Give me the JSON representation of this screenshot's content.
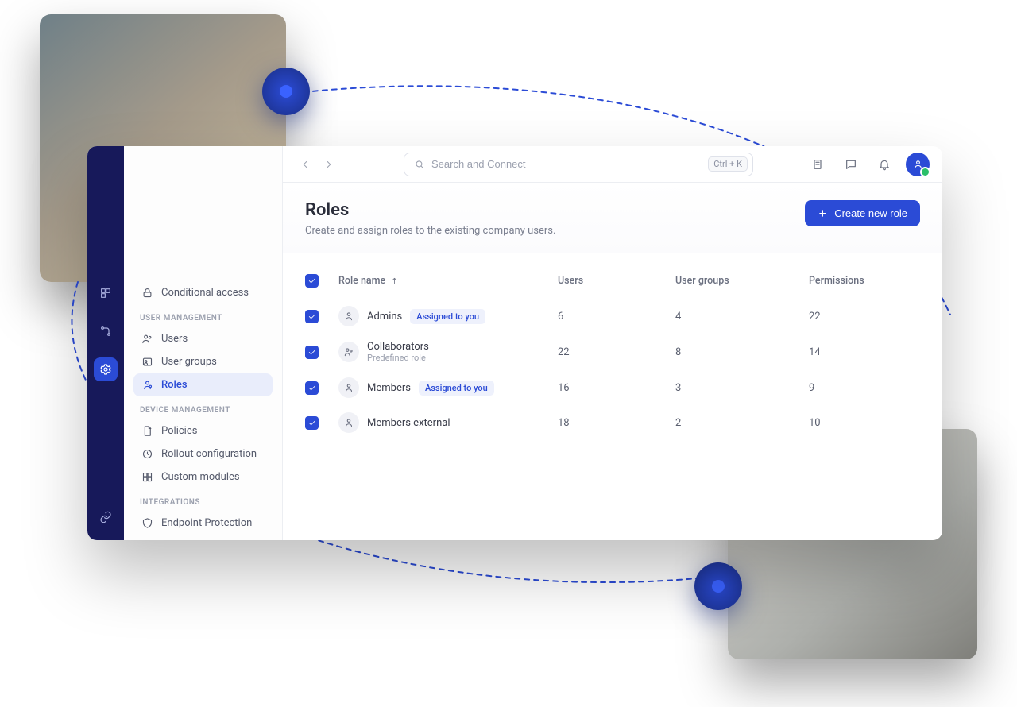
{
  "search": {
    "placeholder": "Search and Connect",
    "shortcut": "Ctrl + K"
  },
  "page": {
    "title": "Roles",
    "subtitle": "Create and assign roles to the existing company users.",
    "cta_label": "Create new role"
  },
  "sidebar": {
    "top_item": "Conditional access",
    "sections": [
      {
        "label": "USER MANAGEMENT",
        "items": [
          "Users",
          "User groups",
          "Roles"
        ]
      },
      {
        "label": "DEVICE MANAGEMENT",
        "items": [
          "Policies",
          "Rollout configuration",
          "Custom modules"
        ]
      },
      {
        "label": "INTEGRATIONS",
        "items": [
          "Endpoint Protection"
        ]
      }
    ]
  },
  "table": {
    "columns": [
      "Role name",
      "Users",
      "User groups",
      "Permissions"
    ],
    "badge_label": "Assigned to you",
    "predefined_label": "Predefined role",
    "rows": [
      {
        "name": "Admins",
        "badge": true,
        "sub": null,
        "users": "6",
        "groups": "4",
        "perms": "22"
      },
      {
        "name": "Collaborators",
        "badge": false,
        "sub": "Predefined role",
        "users": "22",
        "groups": "8",
        "perms": "14"
      },
      {
        "name": "Members",
        "badge": true,
        "sub": null,
        "users": "16",
        "groups": "3",
        "perms": "9"
      },
      {
        "name": "Members external",
        "badge": false,
        "sub": null,
        "users": "18",
        "groups": "2",
        "perms": "10"
      }
    ]
  }
}
